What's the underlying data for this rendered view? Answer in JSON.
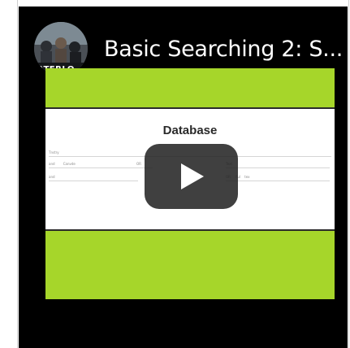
{
  "video": {
    "title": "Basic Searching 2: S...",
    "channel_avatar_text": "ATERLO"
  },
  "thumbnail": {
    "heading": "Database",
    "row_texts": [
      "Tnstry",
      "and",
      "Canvde",
      "OR",
      "and",
      "Text",
      "OR",
      "Ful",
      "tex"
    ],
    "accent_color": "#a6d62a"
  },
  "controls": {
    "play_icon": "play-icon"
  }
}
